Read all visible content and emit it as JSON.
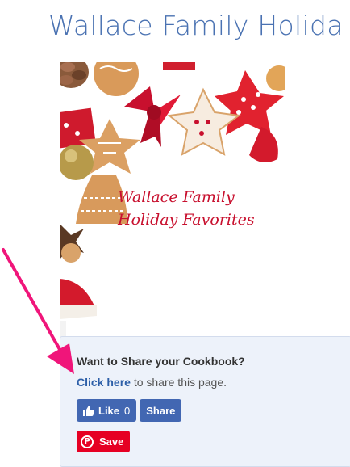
{
  "header": {
    "title": "Wallace Family Holida"
  },
  "cover": {
    "line1": "Wallace Family",
    "line2": "Holiday Favorites"
  },
  "share": {
    "heading": "Want to Share your Cookbook?",
    "link_text": "Click here",
    "line_rest": " to share this page.",
    "like_label": "Like",
    "like_count": "0",
    "share_label": "Share",
    "pin_icon": "P",
    "pin_label": "Save"
  },
  "colors": {
    "title": "#4a72b2",
    "facebook": "#4267b2",
    "pinterest": "#e60023",
    "arrow": "#f0157a"
  }
}
